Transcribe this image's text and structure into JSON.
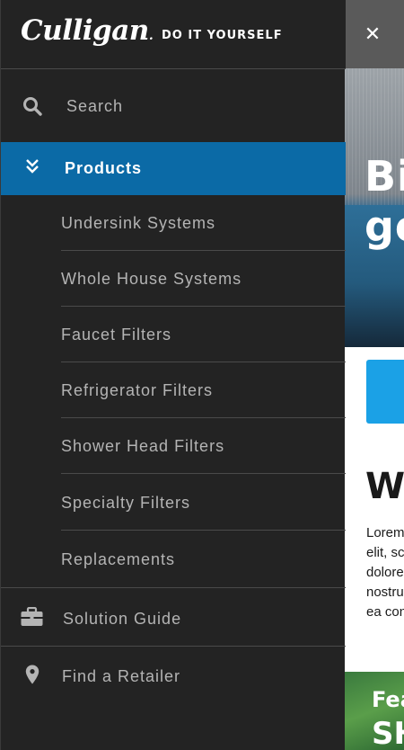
{
  "header": {
    "logo_text": "Culligan",
    "logo_mark": ".",
    "diy_link": "DO IT YOURSELF",
    "close_glyph": "✕"
  },
  "menu": {
    "search_label": "Search",
    "products_label": "Products",
    "product_items": [
      {
        "label": "Undersink Systems"
      },
      {
        "label": "Whole House Systems"
      },
      {
        "label": "Faucet Filters"
      },
      {
        "label": "Refrigerator Filters"
      },
      {
        "label": "Shower Head Filters"
      },
      {
        "label": "Specialty Filters"
      },
      {
        "label": "Replacements"
      }
    ],
    "solution_guide_label": "Solution Guide",
    "find_retailer_label": "Find a Retailer"
  },
  "background_page": {
    "hero_line1": "Bi",
    "hero_line2": "go",
    "section_heading": "Wl",
    "body_lines": [
      "Lorem",
      "elit, sc",
      "dolore",
      "nostru",
      "ea con"
    ],
    "feature_kicker": "Fea",
    "feature_title": "SH"
  },
  "colors": {
    "drawer_bg": "#232323",
    "active_item_bg": "#0b6aa6",
    "menu_text": "#b4b4b4",
    "cta_blue": "#1ba1e6",
    "topbar_gray": "#5a5a5a"
  },
  "icons": {
    "search": "search-icon",
    "products": "chevrons-down-icon",
    "solution_guide": "briefcase-icon",
    "retailer": "map-pin-icon",
    "close": "close-icon"
  }
}
